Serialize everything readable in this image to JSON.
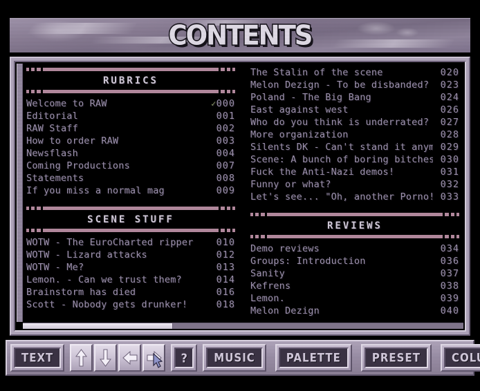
{
  "banner": {
    "title": "CONTENTS"
  },
  "sections": [
    {
      "id": "rubrics",
      "column": "left",
      "title": "RUBRICS",
      "entries": [
        {
          "title": "Welcome to RAW",
          "mark": "✓",
          "number": "000"
        },
        {
          "title": "Editorial",
          "mark": "",
          "number": "001"
        },
        {
          "title": "RAW Staff",
          "mark": "",
          "number": "002"
        },
        {
          "title": "How to order RAW",
          "mark": "",
          "number": "003"
        },
        {
          "title": "Newsflash",
          "mark": "",
          "number": "004"
        },
        {
          "title": "Coming Productions",
          "mark": "",
          "number": "007"
        },
        {
          "title": "Statements",
          "mark": "",
          "number": "008"
        },
        {
          "title": "If you miss a normal mag",
          "mark": "",
          "number": "009"
        }
      ]
    },
    {
      "id": "scene-stuff",
      "column": "left",
      "title": "SCENE STUFF",
      "entries": [
        {
          "title": "WOTW - The EuroCharted ripper",
          "mark": "",
          "number": "010"
        },
        {
          "title": "WOTW - Lizard attacks",
          "mark": "",
          "number": "012"
        },
        {
          "title": "WOTW - Me?",
          "mark": "",
          "number": "013"
        },
        {
          "title": "Lemon. - Can we trust them?",
          "mark": "",
          "number": "014"
        },
        {
          "title": "Brainstorm has died",
          "mark": "",
          "number": "016"
        },
        {
          "title": "Scott - Nobody gets drunker!",
          "mark": "",
          "number": "018"
        }
      ]
    },
    {
      "id": "scene-stuff-continued",
      "column": "right",
      "title": "",
      "entries": [
        {
          "title": "The Stalin of the scene",
          "mark": "",
          "number": "020"
        },
        {
          "title": "Melon Dezign - To be disbanded?",
          "mark": "",
          "number": "023"
        },
        {
          "title": "Poland - The Big Bang",
          "mark": "",
          "number": "024"
        },
        {
          "title": "East against west",
          "mark": "",
          "number": "026"
        },
        {
          "title": "Who do you think is underrated?",
          "mark": "",
          "number": "027"
        },
        {
          "title": "More organization",
          "mark": "",
          "number": "028"
        },
        {
          "title": "Silents DK - Can't stand it anymore",
          "mark": "",
          "number": "029"
        },
        {
          "title": "Scene: A bunch of boring bitches!",
          "mark": "",
          "number": "030"
        },
        {
          "title": "Fuck the Anti-Nazi demos!",
          "mark": "",
          "number": "031"
        },
        {
          "title": "Funny or what?",
          "mark": "",
          "number": "032"
        },
        {
          "title": "Let's see... \"Oh, another Porno!\"",
          "mark": "",
          "number": "033"
        }
      ]
    },
    {
      "id": "reviews",
      "column": "right",
      "title": "REVIEWS",
      "entries": [
        {
          "title": "Demo reviews",
          "mark": "",
          "number": "034"
        },
        {
          "title": "Groups: Introduction",
          "mark": "",
          "number": "036"
        },
        {
          "title": "Sanity",
          "mark": "",
          "number": "037"
        },
        {
          "title": "Kefrens",
          "mark": "",
          "number": "038"
        },
        {
          "title": "Lemon.",
          "mark": "",
          "number": "039"
        },
        {
          "title": "Melon Dezign",
          "mark": "",
          "number": "040"
        }
      ]
    }
  ],
  "toolbar": {
    "text_label": "TEXT",
    "up_icon": "arrow-up-icon",
    "down_icon": "arrow-down-icon",
    "left_icon": "arrow-left-icon",
    "right_icon": "arrow-right-icon",
    "help_label": "?",
    "music_label": "MUSIC",
    "palette_label": "PALETTE",
    "preset_label": "PRESET",
    "columns_label": "COLUMNS"
  },
  "colors": {
    "background": "#000000",
    "panel_face": "#ada2b8",
    "banner_base": "#8e8199",
    "entry_text": "#9b90ab",
    "section_title": "#cfc8d6",
    "rule": "#b0879b",
    "read_mark": "#8e9b6a",
    "button_face": "#3a3243",
    "button_label": "#cfc6d8"
  }
}
